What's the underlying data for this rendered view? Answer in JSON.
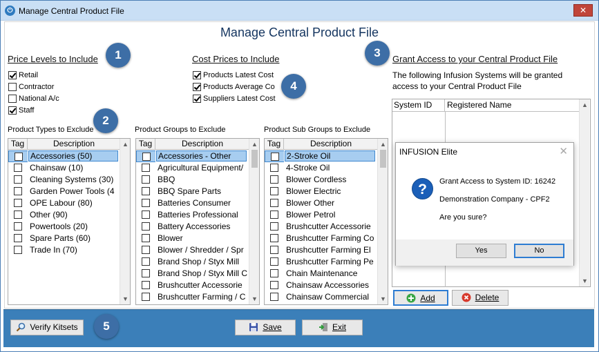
{
  "window": {
    "title": "Manage Central Product File",
    "close_glyph": "✕",
    "app_icon_glyph": "⏻"
  },
  "main_title": "Manage Central Product File",
  "badges": [
    "1",
    "2",
    "3",
    "4",
    "5"
  ],
  "price_levels": {
    "heading": "Price Levels to Include",
    "items": [
      {
        "label": "Retail",
        "checked": true
      },
      {
        "label": "Contractor",
        "checked": false
      },
      {
        "label": "National A/c",
        "checked": false
      },
      {
        "label": "Staff",
        "checked": true
      }
    ]
  },
  "cost_prices": {
    "heading": "Cost Prices to Include",
    "items": [
      {
        "label": "Products Latest Cost",
        "checked": true
      },
      {
        "label": "Products Average Co",
        "checked": true
      },
      {
        "label": "Suppliers Latest Cost",
        "checked": true
      }
    ]
  },
  "product_types": {
    "label": "Product Types to Exclude",
    "col_tag": "Tag",
    "col_desc": "Description",
    "rows": [
      "Accessories (50)",
      "Chainsaw (10)",
      "Cleaning Systems (30)",
      "Garden Power Tools (4",
      "OPE Labour (80)",
      "Other (90)",
      "Powertools (20)",
      "Spare Parts (60)",
      "Trade In (70)"
    ],
    "selected_index": 0
  },
  "product_groups": {
    "label": "Product Groups to Exclude",
    "col_tag": "Tag",
    "col_desc": "Description",
    "rows": [
      "Accessories - Other",
      "Agricultural Equipment/",
      "BBQ",
      "BBQ Spare Parts",
      "Batteries Consumer",
      "Batteries Professional",
      "Battery Accessories",
      "Blower",
      "Blower / Shredder / Spr",
      "Brand Shop / Styx Mill",
      "Brand Shop / Styx Mill C",
      "Brushcutter Accessorie",
      "Brushcutter Farming / C"
    ],
    "selected_index": 0
  },
  "product_sub_groups": {
    "label": "Product Sub Groups to Exclude",
    "col_tag": "Tag",
    "col_desc": "Description",
    "rows": [
      "2-Stroke Oil",
      "4-Stroke Oil",
      "Blower Cordless",
      "Blower Electric",
      "Blower Other",
      "Blower Petrol",
      "Brushcutter Accessorie",
      "Brushcutter Farming Co",
      "Brushcutter Farming El",
      "Brushcutter Farming Pe",
      "Chain Maintenance",
      "Chainsaw Accessories",
      "Chainsaw Commercial"
    ],
    "selected_index": 0
  },
  "grant_access": {
    "heading": "Grant Access to your Central Product File",
    "description": "The following Infusion Systems will be granted access to your Central Product File",
    "col_system_id": "System ID",
    "col_registered_name": "Registered Name",
    "add_label": "Add",
    "delete_label": "Delete"
  },
  "dialog": {
    "title": "INFUSION Elite",
    "close_glyph": "✕",
    "icon_glyph": "?",
    "line1": "Grant Access to System ID: 16242",
    "line2": "Demonstration Company - CPF2",
    "line3": "Are you sure?",
    "yes_label": "Yes",
    "no_label": "No"
  },
  "footer": {
    "verify_label": "Verify Kitsets",
    "save_label": "Save",
    "exit_label": "Exit"
  },
  "scroll_glyphs": {
    "up": "▲",
    "down": "▼"
  },
  "colors": {
    "accent": "#3b7fb9",
    "badge": "#3d6ea6",
    "selection": "#a7cdf0",
    "title_text": "#13345f"
  }
}
